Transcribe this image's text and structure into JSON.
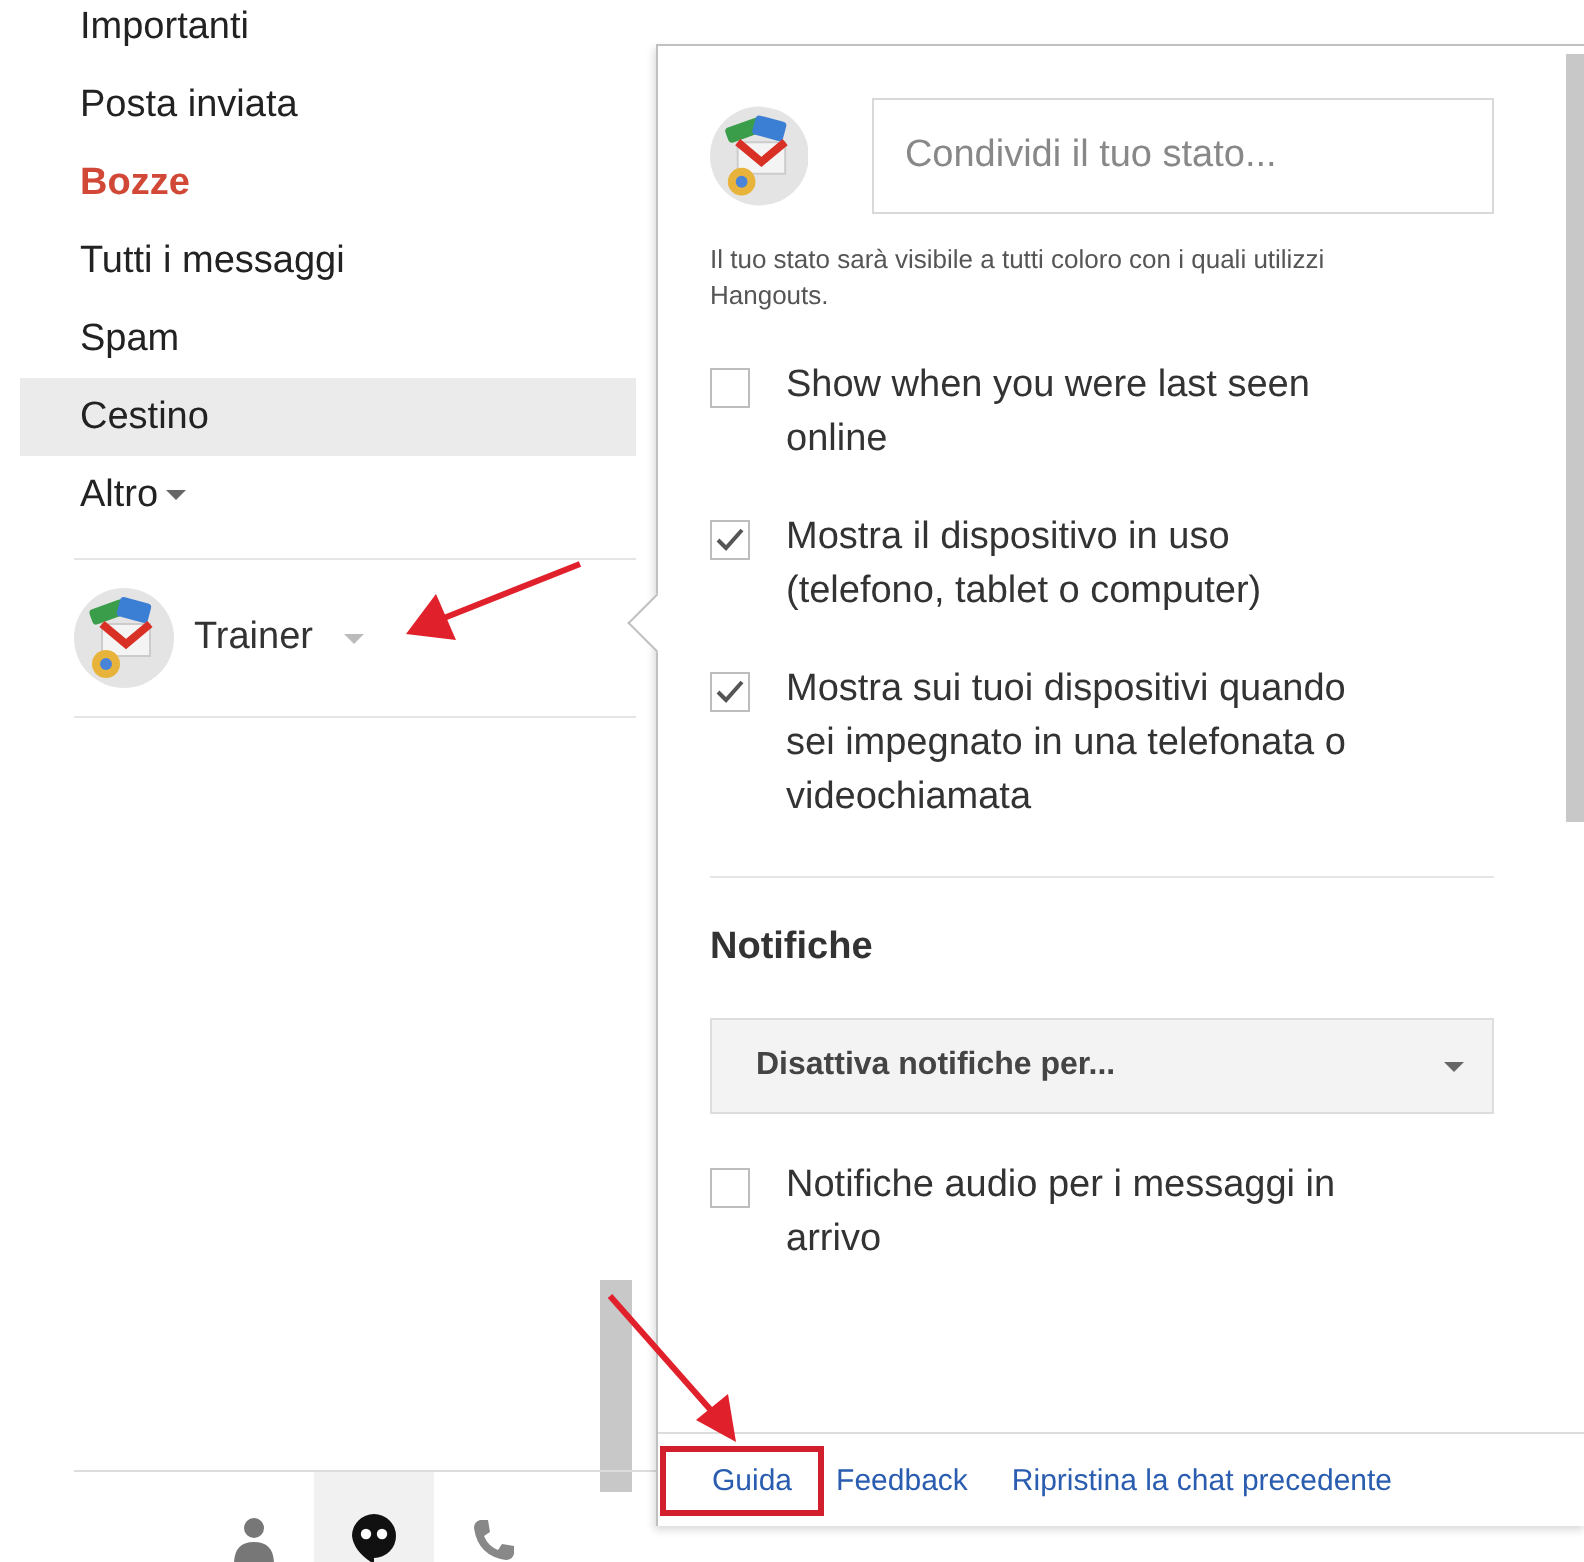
{
  "sidebar": {
    "items": [
      {
        "label": "Importanti",
        "kind": "label",
        "emphasized": false,
        "selected": false
      },
      {
        "label": "Posta inviata",
        "kind": "label",
        "emphasized": false,
        "selected": false
      },
      {
        "label": "Bozze",
        "kind": "label",
        "emphasized": true,
        "selected": false
      },
      {
        "label": "Tutti i messaggi",
        "kind": "label",
        "emphasized": false,
        "selected": false
      },
      {
        "label": "Spam",
        "kind": "label",
        "emphasized": false,
        "selected": false
      },
      {
        "label": "Cestino",
        "kind": "label",
        "emphasized": false,
        "selected": true
      },
      {
        "label": "Altro",
        "kind": "more",
        "emphasized": false,
        "selected": false
      }
    ]
  },
  "account": {
    "name": "Trainer"
  },
  "bottom_tabs": [
    {
      "kind": "contacts",
      "selected": false
    },
    {
      "kind": "hangouts",
      "selected": true
    },
    {
      "kind": "phone",
      "selected": false
    }
  ],
  "popup": {
    "status_field": {
      "placeholder": "Condividi il tuo stato..."
    },
    "status_note": "Il tuo stato sarà visibile a tutti coloro con i quali utilizzi Hangouts.",
    "options": [
      {
        "label": "Show when you were last seen online",
        "checked": false
      },
      {
        "label": "Mostra il dispositivo in uso (telefono, tablet o computer)",
        "checked": true
      },
      {
        "label": "Mostra sui tuoi dispositivi quando sei impegnato in una telefonata o videochiamata",
        "checked": true
      }
    ],
    "notifications": {
      "title": "Notifiche",
      "dropdown": "Disattiva notifiche per...",
      "options": [
        {
          "label": "Notifiche audio per i messaggi in arrivo",
          "checked": false
        }
      ]
    },
    "footer_links": [
      "Guida",
      "Feedback",
      "Ripristina la chat precedente"
    ]
  }
}
